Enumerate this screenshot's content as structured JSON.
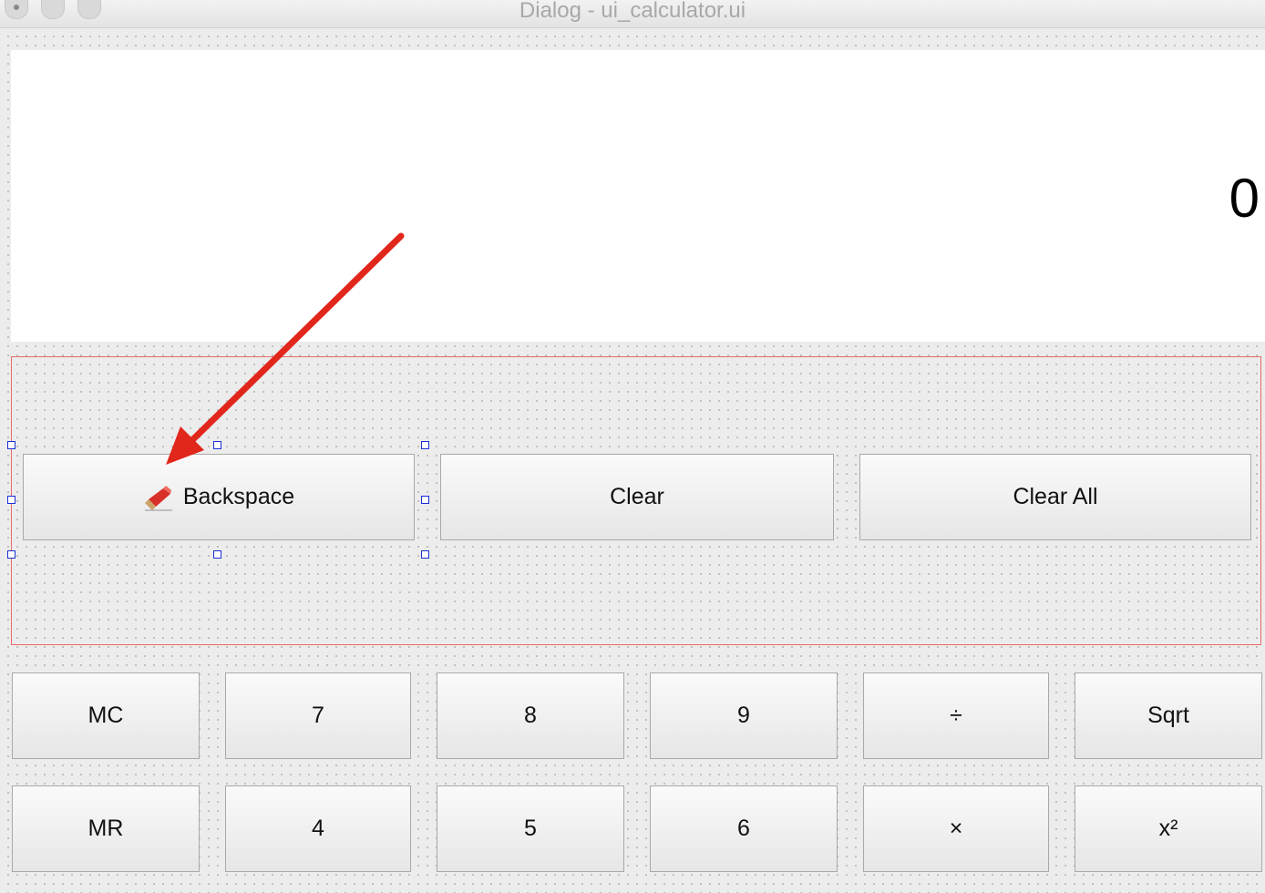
{
  "window": {
    "title": "Dialog - ui_calculator.ui"
  },
  "display": {
    "value": "0"
  },
  "top_row": {
    "backspace_label": "Backspace",
    "backspace_icon": "eraser-icon",
    "clear_label": "Clear",
    "clear_all_label": "Clear All"
  },
  "grid": {
    "row1": [
      "MC",
      "7",
      "8",
      "9",
      "÷",
      "Sqrt"
    ],
    "row2": [
      "MR",
      "4",
      "5",
      "6",
      "×",
      "x²"
    ]
  },
  "annotation": {
    "arrow_color": "#e1261c",
    "selection_color": "#1a2fd6",
    "layout_border_color": "#e86a6a"
  }
}
